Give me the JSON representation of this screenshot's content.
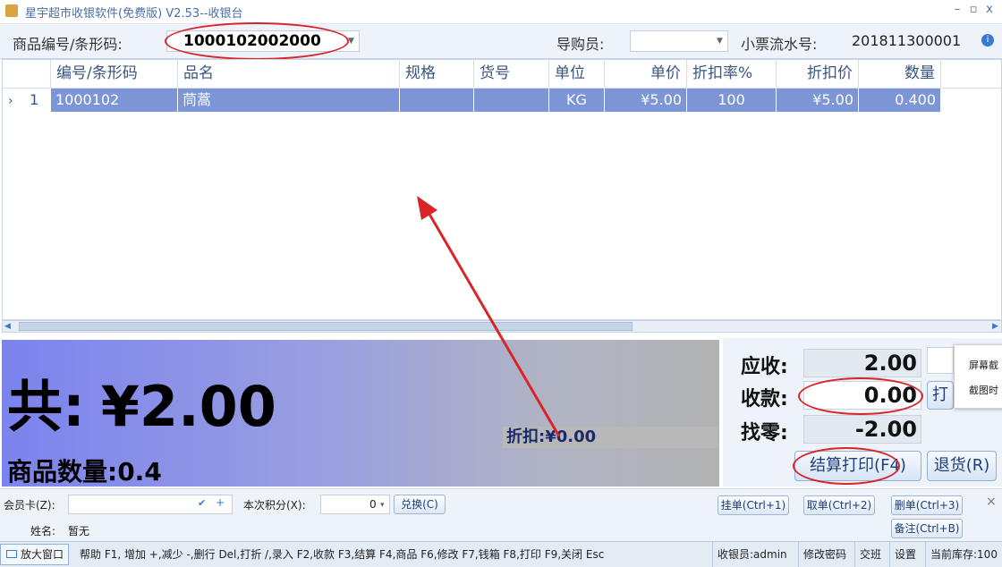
{
  "window": {
    "title": "星宇超市收银软件(免费版) V2.53--收银台",
    "controls": [
      "–",
      "▫",
      "x"
    ]
  },
  "toolbar": {
    "barcode_label": "商品编号/条形码:",
    "barcode_value": "1000102002000",
    "guide_label": "导购员:",
    "guide_value": "",
    "receipt_label": "小票流水号:",
    "receipt_value": "201811300001"
  },
  "table": {
    "headers": [
      "编号/条形码",
      "品名",
      "规格",
      "货号",
      "单位",
      "单价",
      "折扣率%",
      "折扣价",
      "数量"
    ],
    "rows": [
      {
        "index": "1",
        "code": "1000102",
        "name": "茼蒿",
        "spec": "",
        "item_no": "",
        "unit": "KG",
        "price": "¥5.00",
        "discount_rate": "100",
        "discount_price": "¥5.00",
        "qty": "0.400"
      }
    ]
  },
  "summary": {
    "total_label": "共:",
    "total_value": "¥2.00",
    "discount_label": "折扣:",
    "discount_value": "¥0.00",
    "qty_label": "商品数量:",
    "qty_value": "0.4"
  },
  "payment": {
    "receivable_label": "应收:",
    "receivable_value": "2.00",
    "received_label": "收款:",
    "received_value": "0.00",
    "change_label": "找零:",
    "change_value": "-2.00",
    "print_partial": "打",
    "checkout_button": "结算打印(F4)",
    "return_button": "退货(R)"
  },
  "popup": {
    "line1": "屏幕截",
    "line2": "截图时"
  },
  "member": {
    "card_label": "会员卡(Z):",
    "points_label": "本次积分(X):",
    "points_value": "0",
    "redeem_button": "兑换(C)",
    "name_label": "姓名:",
    "name_value": "暂无",
    "hold_button": "挂单(Ctrl+1)",
    "retrieve_button": "取单(Ctrl+2)",
    "delete_button": "删单(Ctrl+3)",
    "note_button": "备注(Ctrl+B)",
    "close_glyph": "×"
  },
  "statusbar": {
    "enlarge_button": "放大窗口",
    "help_text": "帮助 F1, 增加 +,减少 -,删行 Del,打折 /,录入 F2,收款 F3,结算 F4,商品 F6,修改 F7,钱箱 F8,打印 F9,关闭 Esc",
    "cashier": "收银员:admin",
    "change_password": "修改密码",
    "shift": "交班",
    "settings": "设置",
    "stock": "当前库存:100"
  },
  "colors": {
    "accent": "#4a6ea8",
    "selected_row": "#7c95d6",
    "annotation_red": "#d9242a"
  }
}
